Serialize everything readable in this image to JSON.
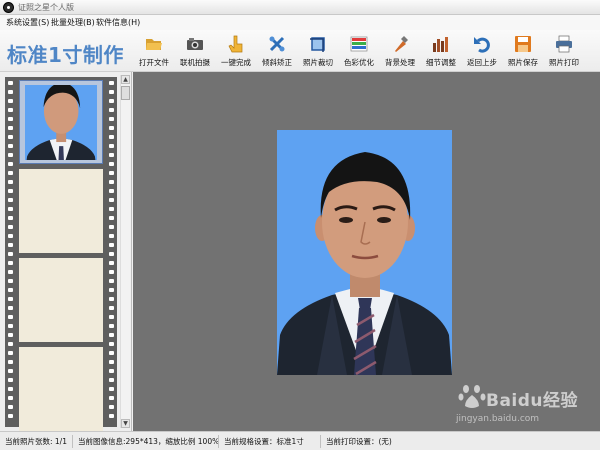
{
  "window": {
    "title": "证照之星个人版"
  },
  "menu": {
    "items": [
      "系统设置(S)",
      "批量处理(B)",
      "软件信息(H)"
    ]
  },
  "header": {
    "title": "标准1寸制作"
  },
  "toolbar": {
    "buttons": [
      {
        "label": "打开文件",
        "icon": "folder-open-icon"
      },
      {
        "label": "联机拍摄",
        "icon": "camera-icon"
      },
      {
        "label": "一键完成",
        "icon": "hand-click-icon"
      },
      {
        "label": "倾斜矫正",
        "icon": "rotate-tools-icon"
      },
      {
        "label": "照片裁切",
        "icon": "crop-icon"
      },
      {
        "label": "色彩优化",
        "icon": "color-bars-icon"
      },
      {
        "label": "背景处理",
        "icon": "background-brush-icon"
      },
      {
        "label": "细节调整",
        "icon": "detail-adjust-icon"
      },
      {
        "label": "返回上步",
        "icon": "undo-arrow-icon"
      },
      {
        "label": "照片保存",
        "icon": "save-floppy-icon"
      },
      {
        "label": "照片打印",
        "icon": "printer-icon"
      }
    ]
  },
  "colors": {
    "accent": "#4f86c6",
    "photo_background": "#5ea2f2",
    "canvas": "#727272",
    "film": "#5f5f5f"
  },
  "status": {
    "photo_count": "当前照片张数: 1/1",
    "image_info": "当前图像信息:295*413，缩放比例 100%",
    "spec": "当前规格设置：标准1寸",
    "print": "当前打印设置：(无)"
  },
  "watermark": {
    "main": "Baidu经验",
    "sub": "jingyan.baidu.com"
  }
}
